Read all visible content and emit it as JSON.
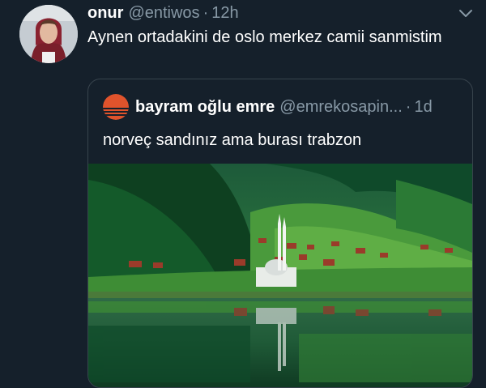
{
  "tweet": {
    "author_name": "onur",
    "author_handle": "@entiwos",
    "separator": "·",
    "timestamp": "12h",
    "text": "Aynen ortadakini de oslo merkez camii sanmistim",
    "menu_icon": "chevron-down-icon"
  },
  "quoted_tweet": {
    "author_name": "bayram oğlu emre",
    "author_handle": "@emrekosapin...",
    "separator": "·",
    "timestamp": "1d",
    "text": "norveç sandınız ama burası trabzon",
    "media": "lakeside town with mosque minarets, green forested hills, reflection in lake"
  },
  "colors": {
    "background": "#15202b",
    "secondary_text": "#8899a6",
    "border": "#38444d",
    "primary_text": "#ffffff"
  }
}
